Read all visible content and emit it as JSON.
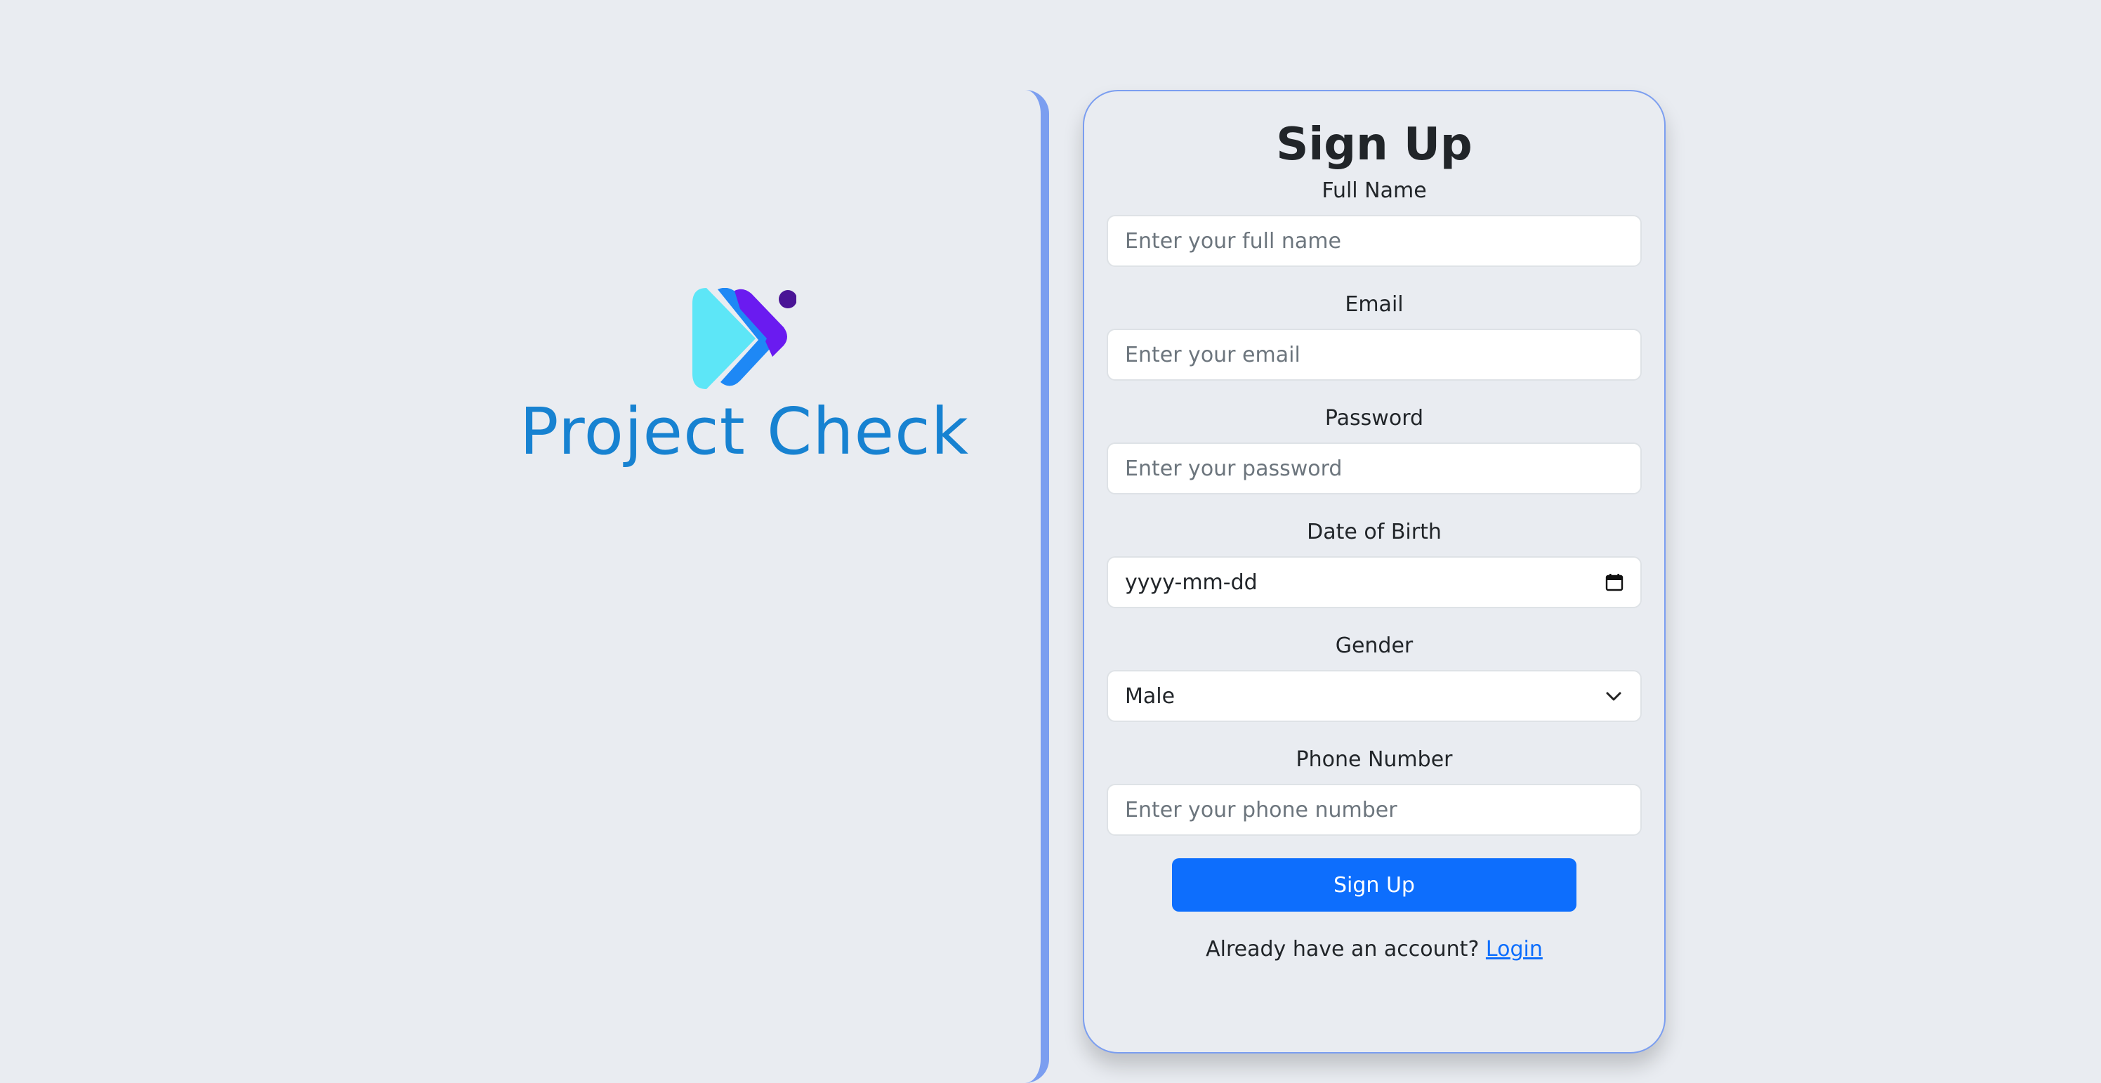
{
  "brand": {
    "name": "Project Check",
    "logo_icon": "double-chevron-logo-icon",
    "colors": {
      "name": "#1782d1",
      "logo_cyan": "#5de6f7",
      "logo_blue": "#1e88f5",
      "logo_purple": "#6a1bf0",
      "logo_dot": "#4a1496"
    }
  },
  "form": {
    "title": "Sign Up",
    "fields": {
      "full_name": {
        "label": "Full Name",
        "placeholder": "Enter your full name",
        "value": ""
      },
      "email": {
        "label": "Email",
        "placeholder": "Enter your email",
        "value": ""
      },
      "password": {
        "label": "Password",
        "placeholder": "Enter your password",
        "value": ""
      },
      "dob": {
        "label": "Date of Birth",
        "value": "yyyy-mm-dd",
        "icon": "calendar-icon"
      },
      "gender": {
        "label": "Gender",
        "value": "Male",
        "icon": "chevron-down-icon"
      },
      "phone": {
        "label": "Phone Number",
        "placeholder": "Enter your phone number",
        "value": ""
      }
    },
    "submit_label": "Sign Up",
    "login_prompt": "Already have an account?",
    "login_link": "Login"
  },
  "colors": {
    "background": "#e9ecf1",
    "accent": "#0d6efd",
    "border_accent": "#7b9ef0"
  }
}
